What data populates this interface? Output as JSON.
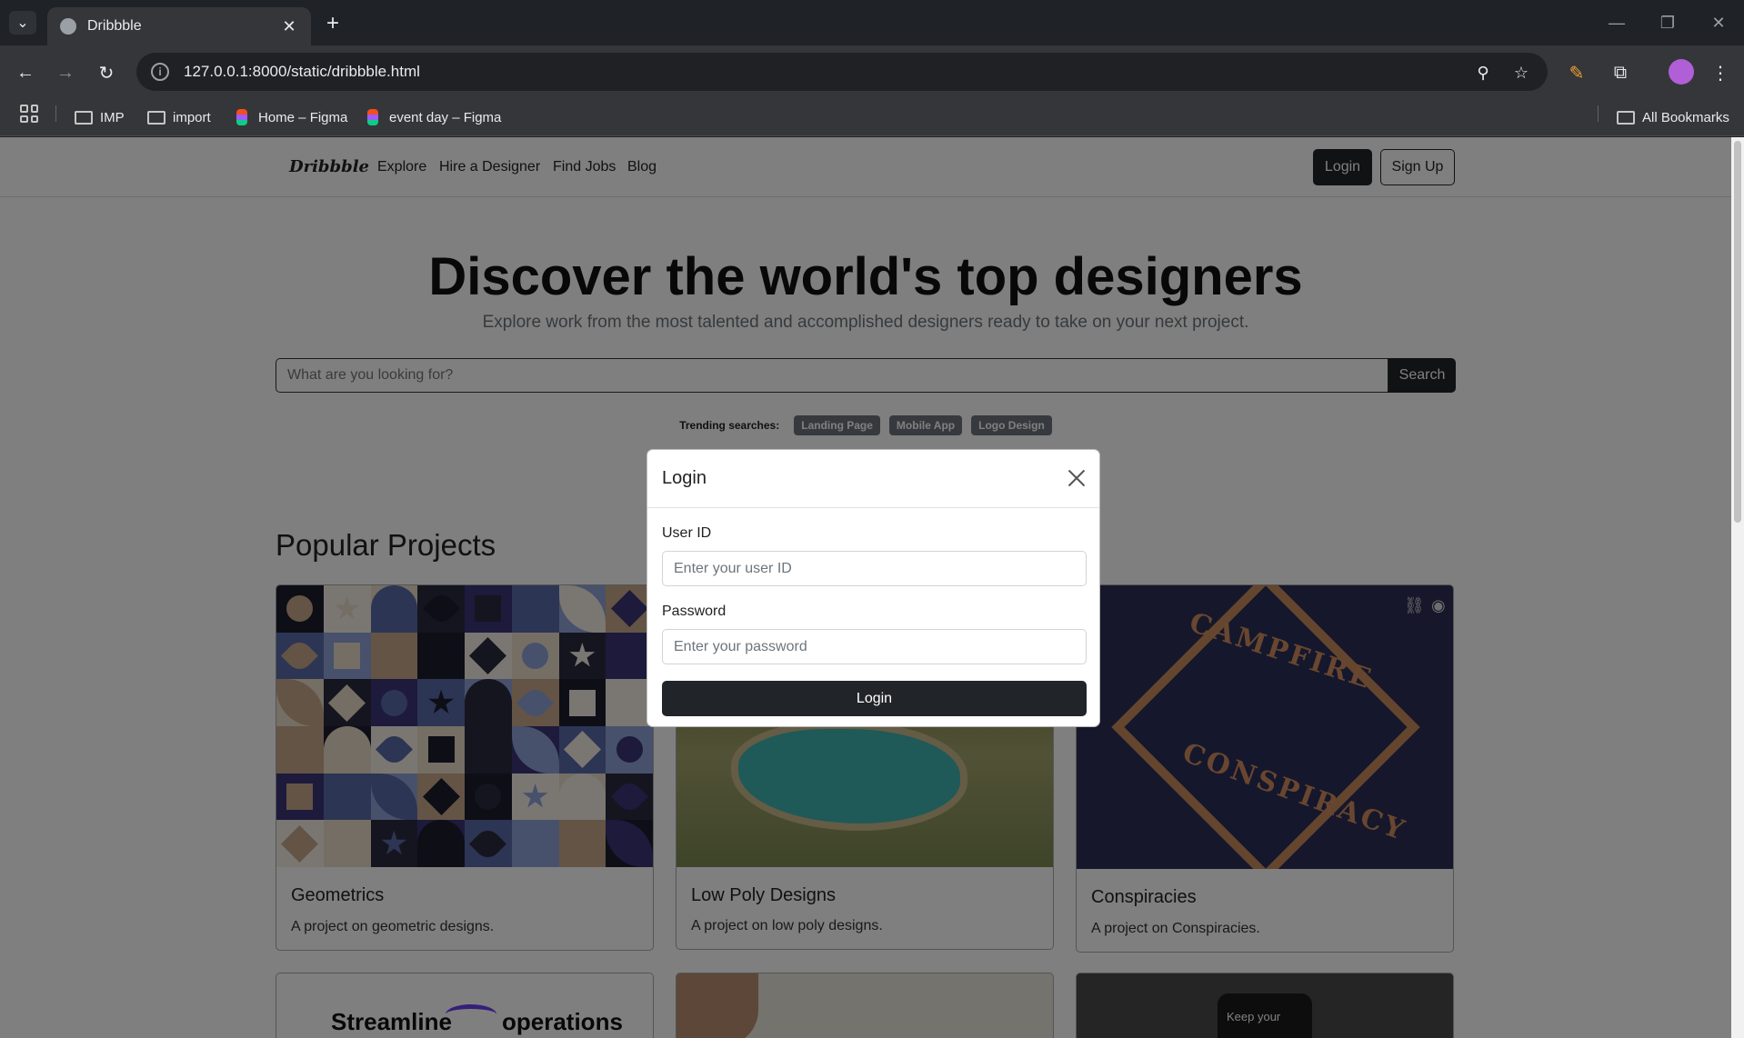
{
  "browser": {
    "tab_title": "Dribbble",
    "url": "127.0.0.1:8000/static/dribbble.html",
    "bookmarks": [
      "IMP",
      "import",
      "Home – Figma",
      "event day – Figma"
    ],
    "all_bookmarks": "All Bookmarks"
  },
  "site": {
    "logo": "Dribbble",
    "nav": [
      "Explore",
      "Hire a Designer",
      "Find Jobs",
      "Blog"
    ],
    "login_label": "Login",
    "signup_label": "Sign Up"
  },
  "hero": {
    "title": "Discover the world's top designers",
    "subtitle": "Explore work from the most talented and accomplished designers ready to take on your next project.",
    "search_placeholder": "What are you looking for?",
    "search_button": "Search",
    "trending_label": "Trending searches:",
    "trending": [
      "Landing Page",
      "Mobile App",
      "Logo Design"
    ]
  },
  "projects": {
    "heading": "Popular Projects",
    "cards": [
      {
        "title": "Geometrics",
        "desc": "A project on geometric designs."
      },
      {
        "title": "Low Poly Designs",
        "desc": "A project on low poly designs."
      },
      {
        "title": "Conspiracies",
        "desc": "A project on Conspiracies."
      }
    ],
    "partial_text": [
      "Streamline",
      "operations",
      "Keep your"
    ],
    "campfire_text": [
      "CAMPFIRE",
      "CONSPIRACY"
    ]
  },
  "modal": {
    "title": "Login",
    "user_label": "User ID",
    "user_placeholder": "Enter your user ID",
    "password_label": "Password",
    "password_placeholder": "Enter your password",
    "submit": "Login"
  },
  "colors": {
    "primary_dark": "#212529",
    "muted": "#6c757d",
    "overlay": "rgba(0,0,0,0.5)"
  }
}
